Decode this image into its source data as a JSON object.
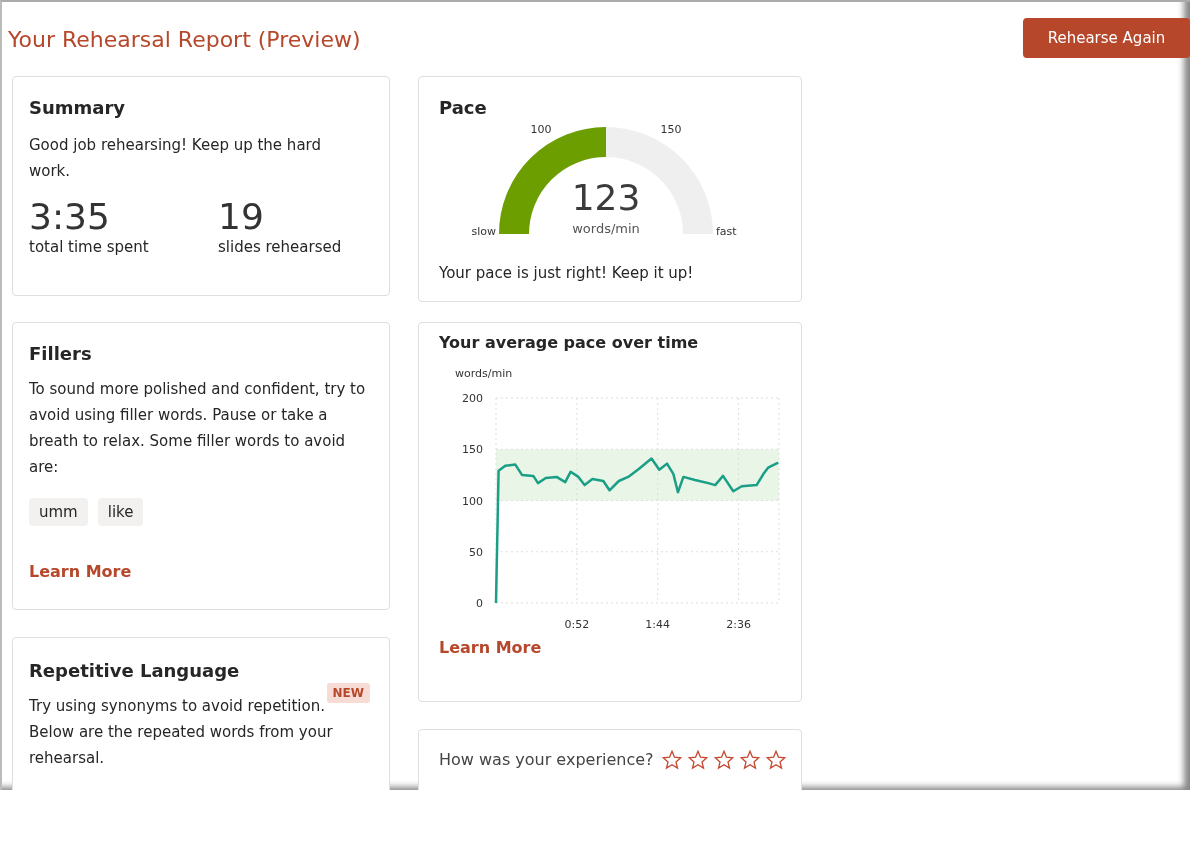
{
  "title": "Your Rehearsal Report (Preview)",
  "rehearse_button": "Rehearse Again",
  "summary": {
    "heading": "Summary",
    "message": "Good job rehearsing! Keep up the hard work.",
    "stats": [
      {
        "value": "3:35",
        "label": "total time spent"
      },
      {
        "value": "19",
        "label": "slides rehearsed"
      }
    ]
  },
  "fillers": {
    "heading": "Fillers",
    "message": "To sound more polished and confident, try to avoid using filler words. Pause or take a breath to relax. Some filler words to avoid are:",
    "words": [
      "umm",
      "like"
    ],
    "link": "Learn More"
  },
  "repetitive": {
    "heading": "Repetitive Language",
    "badge": "NEW",
    "message": "Try using synonyms to avoid repetition. Below are the repeated words from your rehearsal."
  },
  "pace": {
    "heading": "Pace",
    "gauge": {
      "level": 0.5,
      "low_mark": "100",
      "high_mark": "150",
      "slow_label": "slow",
      "fast_label": "fast",
      "value": "123",
      "unit": "words/min"
    },
    "message": "Your pace is just right! Keep it up!"
  },
  "pace_over_time": {
    "heading": "Your average pace over time",
    "link": "Learn More",
    "chart_data": {
      "type": "line",
      "ylabel": "words/min",
      "grid": true,
      "x": [
        0,
        1.7,
        6,
        12.4,
        16.7,
        24,
        27,
        32,
        39,
        44.5,
        48,
        53,
        57,
        62,
        69,
        73,
        79,
        85,
        92,
        100,
        105,
        110,
        114,
        117,
        120.5,
        128,
        136.5,
        141,
        146,
        152.6,
        158,
        167.6,
        172,
        175,
        181.5
      ],
      "series": [
        {
          "color": "#1a9e86",
          "values": [
            0,
            129,
            134,
            135,
            125,
            124,
            117,
            122,
            123,
            118,
            128,
            123,
            115,
            121,
            119,
            110,
            119,
            123,
            131,
            141,
            130,
            136,
            126,
            108,
            123,
            120,
            117,
            115,
            124,
            109,
            114,
            115,
            126,
            132,
            137
          ]
        }
      ],
      "xlim": [
        0,
        182
      ],
      "ylim": [
        0,
        200
      ],
      "yticks": [
        0,
        50,
        100,
        150,
        200
      ],
      "xticks": [
        {
          "value": 52,
          "label": "0:52"
        },
        {
          "value": 104,
          "label": "1:44"
        },
        {
          "value": 156,
          "label": "2:36"
        }
      ],
      "bands": [
        {
          "axis": "y",
          "from": 100,
          "to": 150,
          "color": "#e9f6e7"
        }
      ]
    }
  },
  "feedback": {
    "question": "How was your experience?",
    "stars": 0
  }
}
